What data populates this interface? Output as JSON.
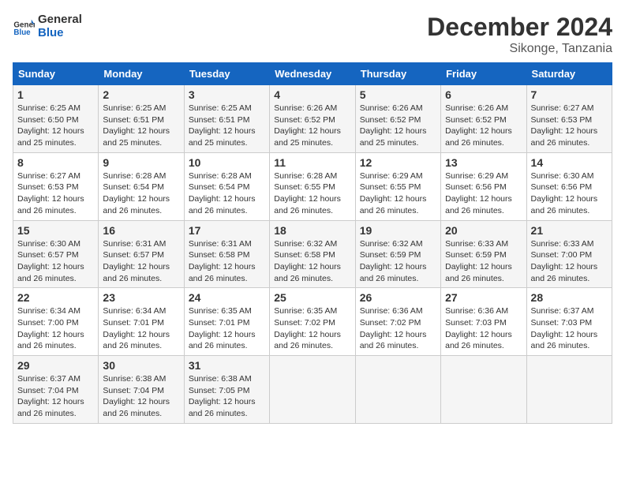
{
  "logo": {
    "line1": "General",
    "line2": "Blue"
  },
  "title": "December 2024",
  "subtitle": "Sikonge, Tanzania",
  "days_of_week": [
    "Sunday",
    "Monday",
    "Tuesday",
    "Wednesday",
    "Thursday",
    "Friday",
    "Saturday"
  ],
  "weeks": [
    [
      {
        "day": "1",
        "sunrise": "6:25 AM",
        "sunset": "6:50 PM",
        "daylight": "12 hours and 25 minutes."
      },
      {
        "day": "2",
        "sunrise": "6:25 AM",
        "sunset": "6:51 PM",
        "daylight": "12 hours and 25 minutes."
      },
      {
        "day": "3",
        "sunrise": "6:25 AM",
        "sunset": "6:51 PM",
        "daylight": "12 hours and 25 minutes."
      },
      {
        "day": "4",
        "sunrise": "6:26 AM",
        "sunset": "6:52 PM",
        "daylight": "12 hours and 25 minutes."
      },
      {
        "day": "5",
        "sunrise": "6:26 AM",
        "sunset": "6:52 PM",
        "daylight": "12 hours and 25 minutes."
      },
      {
        "day": "6",
        "sunrise": "6:26 AM",
        "sunset": "6:52 PM",
        "daylight": "12 hours and 26 minutes."
      },
      {
        "day": "7",
        "sunrise": "6:27 AM",
        "sunset": "6:53 PM",
        "daylight": "12 hours and 26 minutes."
      }
    ],
    [
      {
        "day": "8",
        "sunrise": "6:27 AM",
        "sunset": "6:53 PM",
        "daylight": "12 hours and 26 minutes."
      },
      {
        "day": "9",
        "sunrise": "6:28 AM",
        "sunset": "6:54 PM",
        "daylight": "12 hours and 26 minutes."
      },
      {
        "day": "10",
        "sunrise": "6:28 AM",
        "sunset": "6:54 PM",
        "daylight": "12 hours and 26 minutes."
      },
      {
        "day": "11",
        "sunrise": "6:28 AM",
        "sunset": "6:55 PM",
        "daylight": "12 hours and 26 minutes."
      },
      {
        "day": "12",
        "sunrise": "6:29 AM",
        "sunset": "6:55 PM",
        "daylight": "12 hours and 26 minutes."
      },
      {
        "day": "13",
        "sunrise": "6:29 AM",
        "sunset": "6:56 PM",
        "daylight": "12 hours and 26 minutes."
      },
      {
        "day": "14",
        "sunrise": "6:30 AM",
        "sunset": "6:56 PM",
        "daylight": "12 hours and 26 minutes."
      }
    ],
    [
      {
        "day": "15",
        "sunrise": "6:30 AM",
        "sunset": "6:57 PM",
        "daylight": "12 hours and 26 minutes."
      },
      {
        "day": "16",
        "sunrise": "6:31 AM",
        "sunset": "6:57 PM",
        "daylight": "12 hours and 26 minutes."
      },
      {
        "day": "17",
        "sunrise": "6:31 AM",
        "sunset": "6:58 PM",
        "daylight": "12 hours and 26 minutes."
      },
      {
        "day": "18",
        "sunrise": "6:32 AM",
        "sunset": "6:58 PM",
        "daylight": "12 hours and 26 minutes."
      },
      {
        "day": "19",
        "sunrise": "6:32 AM",
        "sunset": "6:59 PM",
        "daylight": "12 hours and 26 minutes."
      },
      {
        "day": "20",
        "sunrise": "6:33 AM",
        "sunset": "6:59 PM",
        "daylight": "12 hours and 26 minutes."
      },
      {
        "day": "21",
        "sunrise": "6:33 AM",
        "sunset": "7:00 PM",
        "daylight": "12 hours and 26 minutes."
      }
    ],
    [
      {
        "day": "22",
        "sunrise": "6:34 AM",
        "sunset": "7:00 PM",
        "daylight": "12 hours and 26 minutes."
      },
      {
        "day": "23",
        "sunrise": "6:34 AM",
        "sunset": "7:01 PM",
        "daylight": "12 hours and 26 minutes."
      },
      {
        "day": "24",
        "sunrise": "6:35 AM",
        "sunset": "7:01 PM",
        "daylight": "12 hours and 26 minutes."
      },
      {
        "day": "25",
        "sunrise": "6:35 AM",
        "sunset": "7:02 PM",
        "daylight": "12 hours and 26 minutes."
      },
      {
        "day": "26",
        "sunrise": "6:36 AM",
        "sunset": "7:02 PM",
        "daylight": "12 hours and 26 minutes."
      },
      {
        "day": "27",
        "sunrise": "6:36 AM",
        "sunset": "7:03 PM",
        "daylight": "12 hours and 26 minutes."
      },
      {
        "day": "28",
        "sunrise": "6:37 AM",
        "sunset": "7:03 PM",
        "daylight": "12 hours and 26 minutes."
      }
    ],
    [
      {
        "day": "29",
        "sunrise": "6:37 AM",
        "sunset": "7:04 PM",
        "daylight": "12 hours and 26 minutes."
      },
      {
        "day": "30",
        "sunrise": "6:38 AM",
        "sunset": "7:04 PM",
        "daylight": "12 hours and 26 minutes."
      },
      {
        "day": "31",
        "sunrise": "6:38 AM",
        "sunset": "7:05 PM",
        "daylight": "12 hours and 26 minutes."
      },
      null,
      null,
      null,
      null
    ]
  ],
  "labels": {
    "sunrise": "Sunrise:",
    "sunset": "Sunset:",
    "daylight": "Daylight:"
  },
  "accent_color": "#1565c0"
}
